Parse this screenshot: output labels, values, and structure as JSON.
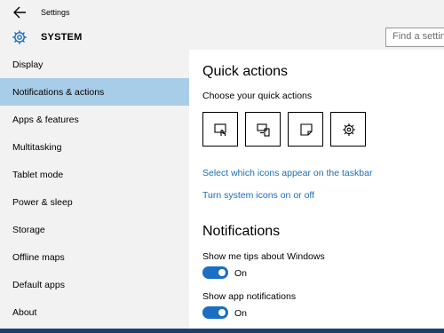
{
  "window": {
    "title": "Settings"
  },
  "header": {
    "section_title": "SYSTEM",
    "search_placeholder": "Find a setting"
  },
  "sidebar": {
    "items": [
      {
        "label": "Display",
        "selected": false
      },
      {
        "label": "Notifications & actions",
        "selected": true
      },
      {
        "label": "Apps & features",
        "selected": false
      },
      {
        "label": "Multitasking",
        "selected": false
      },
      {
        "label": "Tablet mode",
        "selected": false
      },
      {
        "label": "Power & sleep",
        "selected": false
      },
      {
        "label": "Storage",
        "selected": false
      },
      {
        "label": "Offline maps",
        "selected": false
      },
      {
        "label": "Default apps",
        "selected": false
      },
      {
        "label": "About",
        "selected": false
      }
    ]
  },
  "main": {
    "quick_actions": {
      "heading": "Quick actions",
      "subheading": "Choose your quick actions",
      "tiles": [
        {
          "icon": "tablet-mode-icon"
        },
        {
          "icon": "project-icon"
        },
        {
          "icon": "note-icon"
        },
        {
          "icon": "settings-gear-icon"
        }
      ],
      "link_taskbar_icons": "Select which icons appear on the taskbar",
      "link_system_icons": "Turn system icons on or off"
    },
    "notifications": {
      "heading": "Notifications",
      "settings": [
        {
          "label": "Show me tips about Windows",
          "state": "On",
          "on": true
        },
        {
          "label": "Show app notifications",
          "state": "On",
          "on": true
        }
      ]
    }
  },
  "colors": {
    "accent": "#1a6fc2",
    "selected_item_bg": "#a8cde9",
    "link": "#1c6fb8",
    "taskbar": "#1c3f6e"
  }
}
